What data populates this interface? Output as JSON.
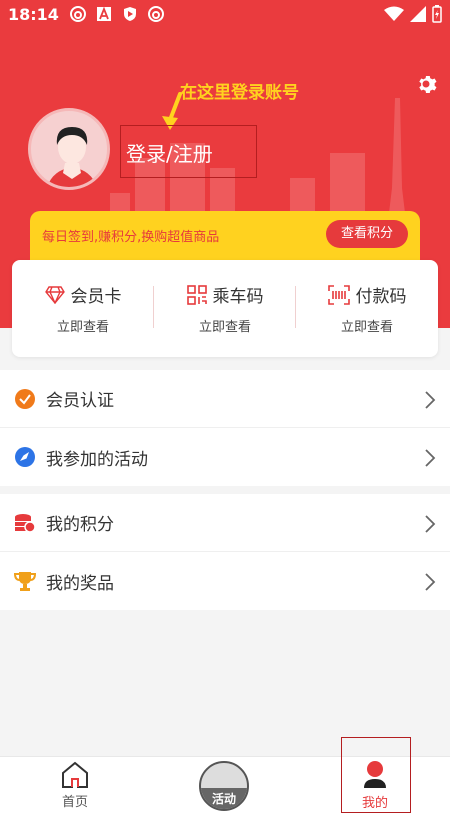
{
  "status_bar": {
    "time": "18:14"
  },
  "header": {
    "hint": "在这里登录账号",
    "login_text": "登录/注册",
    "sign_text": "每日签到,赚积分,换购超值商品",
    "points_button": "查看积分"
  },
  "cards": [
    {
      "title": "会员卡",
      "sub": "立即查看",
      "icon": "diamond-icon"
    },
    {
      "title": "乘车码",
      "sub": "立即查看",
      "icon": "qr-icon"
    },
    {
      "title": "付款码",
      "sub": "立即查看",
      "icon": "barcode-icon"
    }
  ],
  "menu": [
    {
      "label": "会员认证",
      "icon": "verified-icon"
    },
    {
      "label": "我参加的活动",
      "icon": "compass-icon"
    },
    {
      "label": "我的积分",
      "icon": "coins-icon"
    },
    {
      "label": "我的奖品",
      "icon": "trophy-icon"
    }
  ],
  "bottom_nav": {
    "home": "首页",
    "activity": "活动",
    "mine": "我的"
  },
  "colors": {
    "primary": "#ea3b3e",
    "accent": "#ffd21f"
  }
}
